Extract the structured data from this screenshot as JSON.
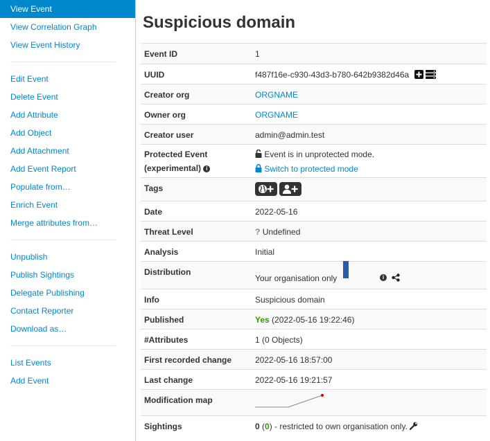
{
  "sidebar": {
    "group1": [
      "View Event",
      "View Correlation Graph",
      "View Event History"
    ],
    "group2": [
      "Edit Event",
      "Delete Event",
      "Add Attribute",
      "Add Object",
      "Add Attachment",
      "Add Event Report",
      "Populate from…",
      "Enrich Event",
      "Merge attributes from…"
    ],
    "group3": [
      "Unpublish",
      "Publish Sightings",
      "Delegate Publishing",
      "Contact Reporter",
      "Download as…"
    ],
    "group4": [
      "List Events",
      "Add Event"
    ]
  },
  "event": {
    "title": "Suspicious domain",
    "labels": {
      "id": "Event ID",
      "uuid": "UUID",
      "creator_org": "Creator org",
      "owner_org": "Owner org",
      "creator_user": "Creator user",
      "protected_1": "Protected Event",
      "protected_2": "(experimental)",
      "tags": "Tags",
      "date": "Date",
      "threat_level": "Threat Level",
      "analysis": "Analysis",
      "distribution": "Distribution",
      "info": "Info",
      "published": "Published",
      "attributes": "#Attributes",
      "first_change": "First recorded change",
      "last_change": "Last change",
      "mod_map": "Modification map",
      "sightings": "Sightings"
    },
    "values": {
      "id": "1",
      "uuid": "f487f16e-c930-43d3-b780-642b9382d46a",
      "creator_org": "ORGNAME",
      "owner_org": "ORGNAME",
      "creator_user": "admin@admin.test",
      "protected_status": "Event is in unprotected mode.",
      "protected_action": "Switch to protected mode",
      "date": "2022-05-16",
      "threat_level": "Undefined",
      "analysis": "Initial",
      "distribution": "Your organisation only",
      "info": "Suspicious domain",
      "published_yes": "Yes",
      "published_date": "(2022-05-16 19:22:46)",
      "attributes": "1 (0 Objects)",
      "first_change": "2022-05-16 18:57:00",
      "last_change": "2022-05-16 19:21:57",
      "sightings_count": "0",
      "sightings_open": " (",
      "sightings_green": "0",
      "sightings_rest": ") - restricted to own organisation only."
    }
  },
  "colors": {
    "link": "#0088cc",
    "active_bg": "#0088cc",
    "published": "#339900",
    "distribution_bar": "#2a5ca8"
  },
  "icons": {
    "uuid": [
      "plus-square-icon",
      "server-icon"
    ],
    "tags": [
      "globe-plus-icon",
      "user-plus-icon"
    ]
  }
}
